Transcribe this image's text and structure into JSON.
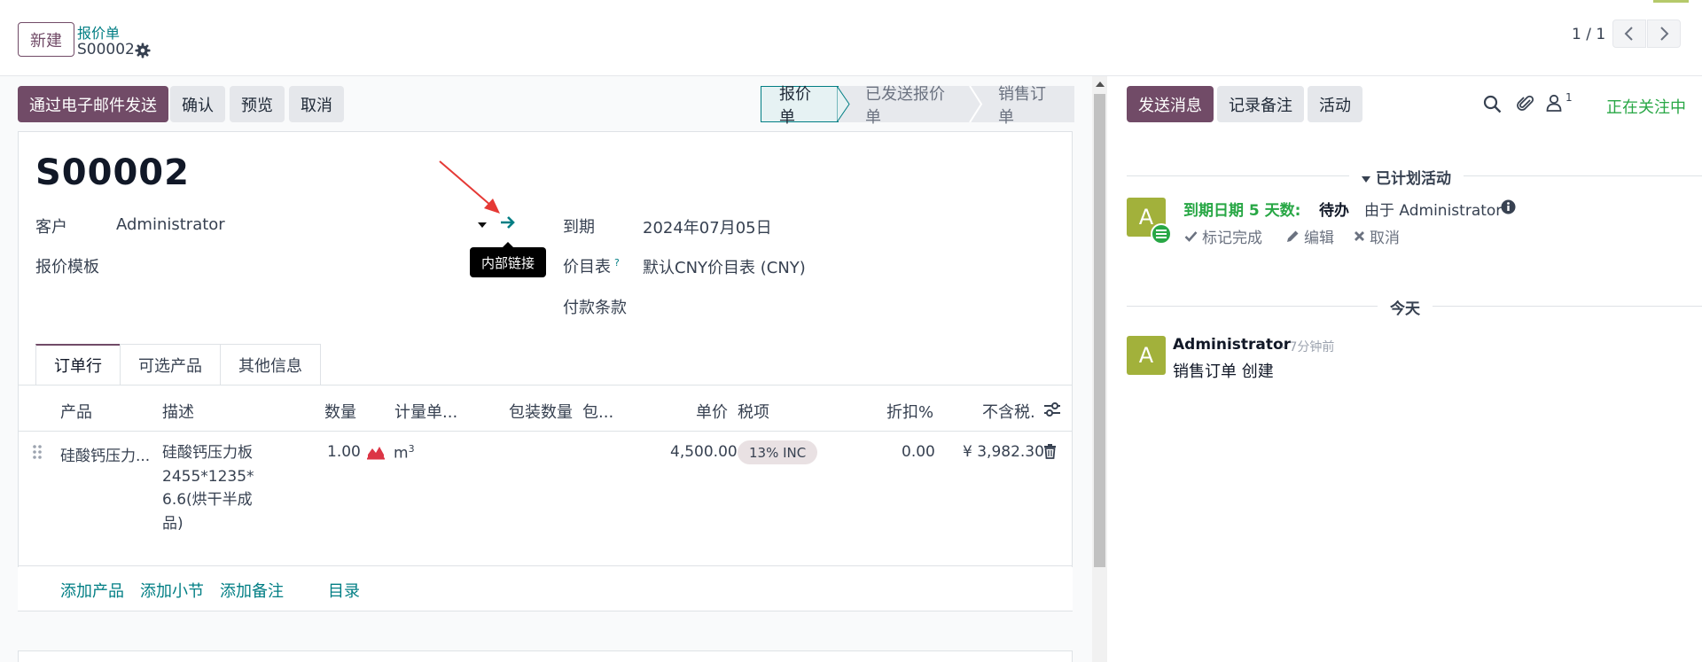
{
  "control_panel": {
    "new_label": "新建",
    "breadcrumb_parent": "报价单",
    "breadcrumb_current": "S00002",
    "pager_value": "1 / 1"
  },
  "actions": {
    "send_email": "通过电子邮件发送",
    "confirm": "确认",
    "preview": "预览",
    "cancel": "取消"
  },
  "statusbar": {
    "stages": [
      "报价单",
      "已发送报价单",
      "销售订单"
    ],
    "current_stage": "报价单"
  },
  "form": {
    "title": "S00002",
    "customer_label": "客户",
    "customer_value": "Administrator",
    "template_label": "报价模板",
    "tooltip": "内部链接",
    "expiry_label": "到期",
    "expiry_value": "2024年07月05日",
    "pricelist_label": "价目表",
    "pricelist_help": "?",
    "pricelist_value": "默认CNY价目表 (CNY)",
    "payment_terms_label": "付款条款"
  },
  "tabs": [
    "订单行",
    "可选产品",
    "其他信息"
  ],
  "order_lines": {
    "columns": {
      "product": "产品",
      "description": "描述",
      "quantity": "数量",
      "uom": "计量单...",
      "packaging_qty": "包装数量",
      "packaging": "包...",
      "unit_price": "单价",
      "taxes": "税项",
      "discount": "折扣%",
      "subtotal": "不含税."
    },
    "rows": [
      {
        "product": "硅酸钙压力...",
        "description": "硅酸钙压力板2455*1235*6.6(烘干半成品)",
        "quantity": "1.00",
        "uom": "m",
        "uom_sup": "3",
        "unit_price": "4,500.00",
        "tax": "13% INC",
        "discount": "0.00",
        "subtotal": "¥ 3,982.30"
      }
    ],
    "add_product": "添加产品",
    "add_section": "添加小节",
    "add_note": "添加备注",
    "catalog": "目录"
  },
  "chatter": {
    "send_message": "发送消息",
    "log_note": "记录备注",
    "activities": "活动",
    "follower_count": "1",
    "following": "正在关注中",
    "planned_header": "已计划活动",
    "activity": {
      "avatar": "A",
      "due": "到期日期 5 天数:",
      "type": "待办",
      "by": "由于 Administrator",
      "mark_done": "标记完成",
      "edit": "编辑",
      "cancel": "取消"
    },
    "today": "今天",
    "message": {
      "avatar": "A",
      "author": "Administrator",
      "time": "- 7分钟前",
      "body": "销售订单 创建"
    }
  },
  "colors": {
    "brand": "#714B67",
    "link": "#017e84",
    "success": "#28a745",
    "avatar": "#a2b13b"
  }
}
